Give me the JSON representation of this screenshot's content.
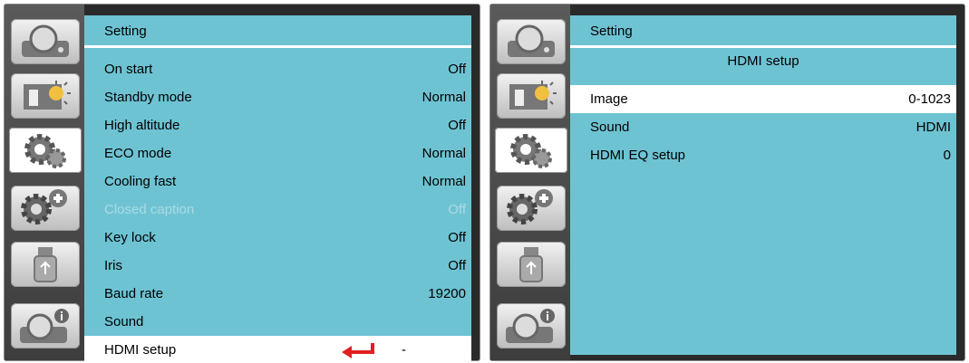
{
  "left_panel": {
    "title": "Setting",
    "items": [
      {
        "label": "On start",
        "value": "Off"
      },
      {
        "label": "Standby mode",
        "value": "Normal"
      },
      {
        "label": "High altitude",
        "value": "Off"
      },
      {
        "label": "ECO mode",
        "value": "Normal"
      },
      {
        "label": "Cooling fast",
        "value": "Normal"
      },
      {
        "label": "Closed caption",
        "value": "Off",
        "disabled": true
      },
      {
        "label": "Key lock",
        "value": "Off"
      },
      {
        "label": "Iris",
        "value": "Off"
      },
      {
        "label": "Baud rate",
        "value": "19200"
      },
      {
        "label": "Sound",
        "value": ""
      },
      {
        "label": "HDMI setup",
        "value": "-",
        "selected": true
      }
    ]
  },
  "right_panel": {
    "title": "Setting",
    "subtitle": "HDMI setup",
    "items": [
      {
        "label": "Image",
        "value": "0-1023",
        "selected": true
      },
      {
        "label": "Sound",
        "value": "HDMI"
      },
      {
        "label": "HDMI EQ setup",
        "value": "0"
      }
    ]
  },
  "sidebar_icons": [
    "projector-icon",
    "brightness-icon",
    "gears-icon",
    "gears-plus-icon",
    "usb-icon",
    "projector-info-icon"
  ],
  "colors": {
    "content_bg": "#6ec3d3",
    "sidebar_bg": "#4a4a4a",
    "enter_arrow": "#e02020"
  }
}
